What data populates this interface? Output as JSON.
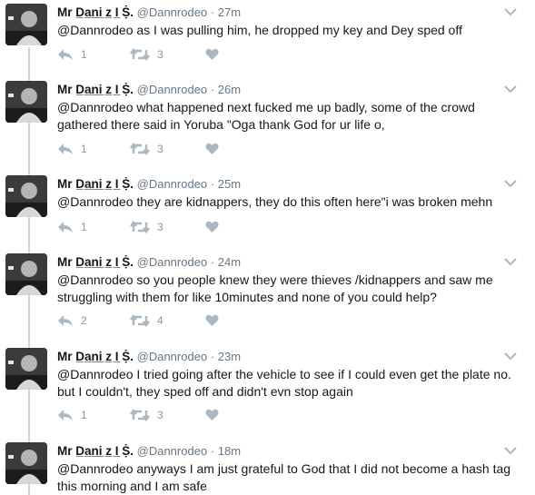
{
  "tweets": [
    {
      "name": "Mr D̲a̲n̲i̲ z̲ I̲ Ṩ.",
      "handle": "@Dannrodeo",
      "time": "27m",
      "text": "@Dannrodeo as I was pulling him, he dropped my key and Dey sped off",
      "replies": "1",
      "retweets": "3"
    },
    {
      "name": "Mr D̲a̲n̲i̲ z̲ I̲ Ṩ.",
      "handle": "@Dannrodeo",
      "time": "26m",
      "text": "@Dannrodeo what happened next fucked me up badly, some of the crowd gathered there said in Yoruba \"Oga thank God for ur life o,",
      "replies": "1",
      "retweets": "3"
    },
    {
      "name": "Mr D̲a̲n̲i̲ z̲ I̲ Ṩ.",
      "handle": "@Dannrodeo",
      "time": "25m",
      "text": "@Dannrodeo they are kidnappers, they do this often here\"i was broken mehn",
      "replies": "1",
      "retweets": "3"
    },
    {
      "name": "Mr D̲a̲n̲i̲ z̲ I̲ Ṩ.",
      "handle": "@Dannrodeo",
      "time": "24m",
      "text": "@Dannrodeo so you people knew they were thieves /kidnappers and saw me struggling with them for like 10minutes and none of you could help?",
      "replies": "2",
      "retweets": "4"
    },
    {
      "name": "Mr D̲a̲n̲i̲ z̲ I̲ Ṩ.",
      "handle": "@Dannrodeo",
      "time": "23m",
      "text": "@Dannrodeo I tried going after the vehicle to see if I could even get the plate no. but I couldn't, they sped off and didn't evn stop again",
      "replies": "1",
      "retweets": "3"
    },
    {
      "name": "Mr D̲a̲n̲i̲ z̲ I̲ Ṩ.",
      "handle": "@Dannrodeo",
      "time": "18m",
      "text": "@Dannrodeo anyways I am just grateful to God that I did not become a hash tag this morning and I am safe",
      "replies": "",
      "retweets": ""
    }
  ],
  "separator": "·",
  "icons": {
    "reply": "reply-icon",
    "retweet": "retweet-icon",
    "like": "heart-icon",
    "menu": "chevron-down-icon"
  },
  "colors": {
    "icon": "#aab8c2",
    "secondary_text": "#657786",
    "thread_line": "#ccd6dd"
  }
}
